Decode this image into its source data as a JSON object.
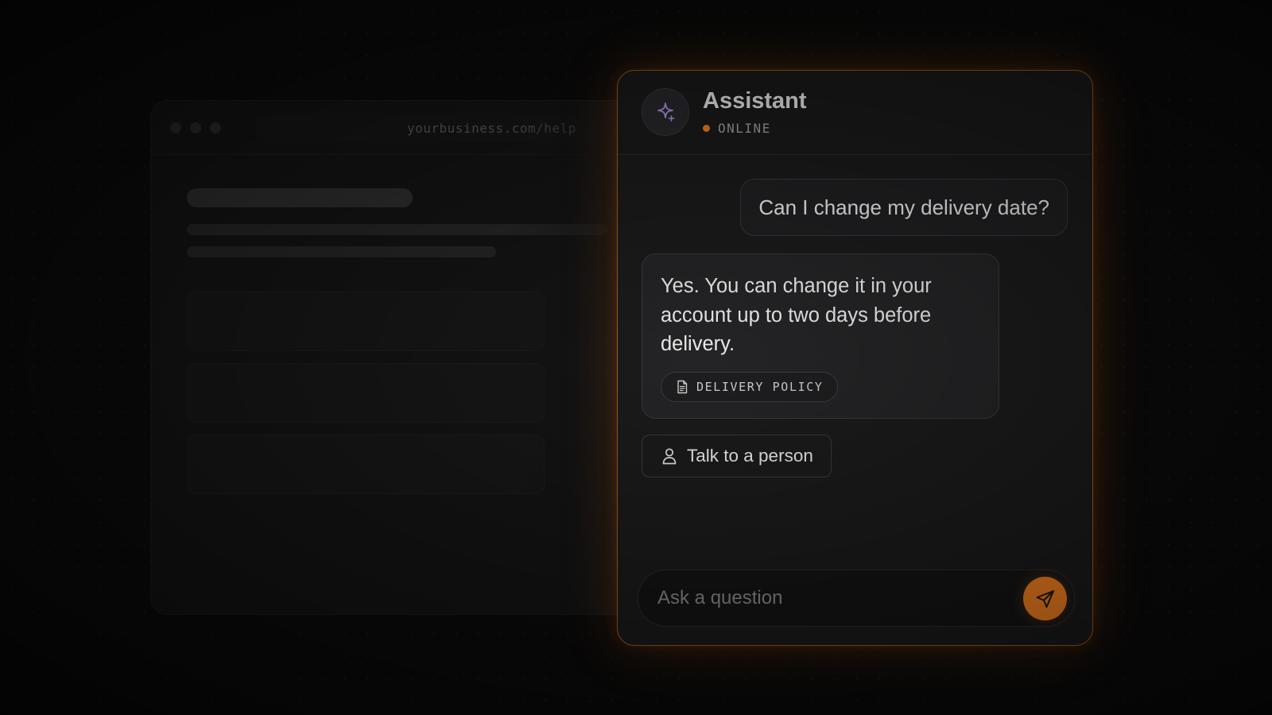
{
  "browser": {
    "url": "yourbusiness.com/help"
  },
  "chat": {
    "assistant_name": "Assistant",
    "status": "ONLINE",
    "avatar_icon": "sparkle-icon",
    "messages": [
      {
        "role": "user",
        "text": "Can I change my delivery date?"
      },
      {
        "role": "assistant",
        "text": "Yes. You can change it in your account up to two days before delivery.",
        "source": {
          "icon": "document-icon",
          "label": "DELIVERY POLICY"
        }
      }
    ],
    "handoff_button": {
      "icon": "person-icon",
      "label": "Talk to a person"
    },
    "composer": {
      "placeholder": "Ask a question",
      "value": "",
      "send_icon": "send-icon"
    }
  },
  "colors": {
    "accent": "#f7821f",
    "panel_border": "#a65f1e",
    "background": "#0b0b0b",
    "panel": "#1b1b1c"
  }
}
